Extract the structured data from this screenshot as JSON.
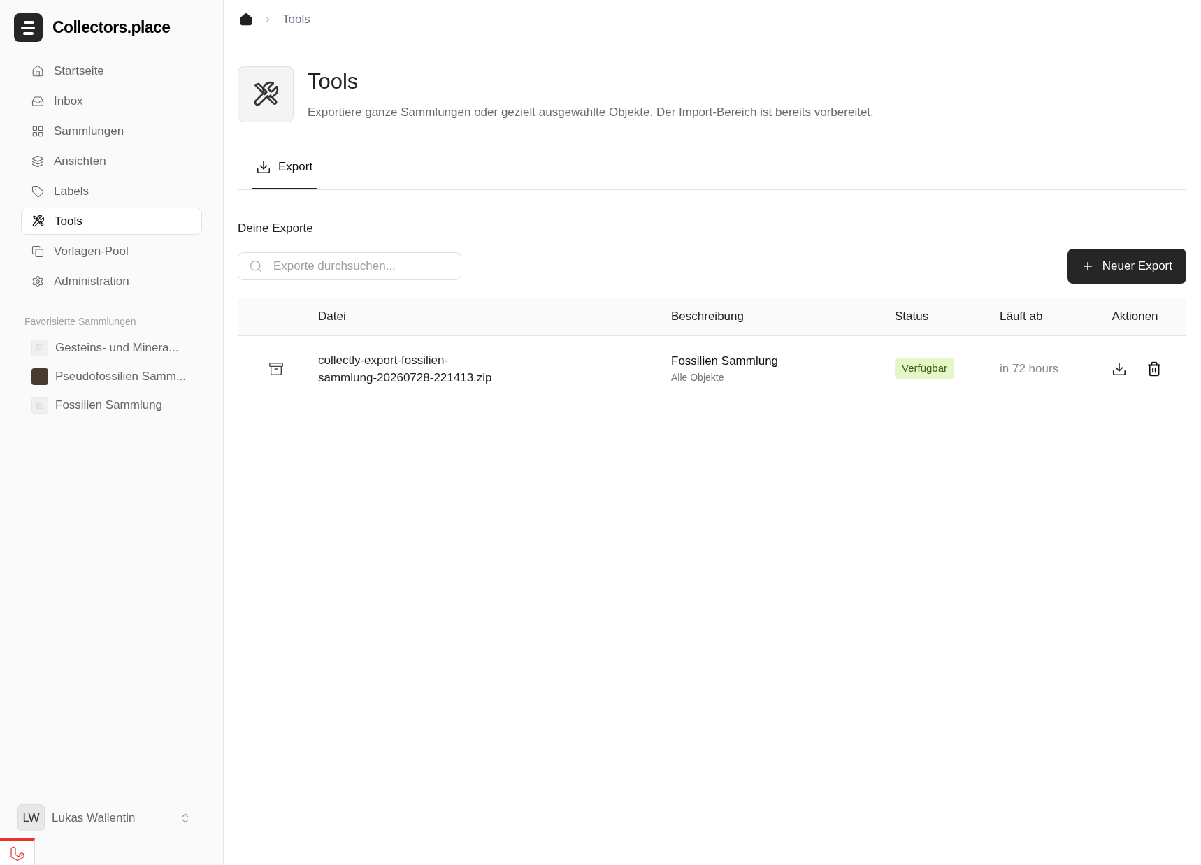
{
  "brand": {
    "name": "Collectors.place"
  },
  "nav": [
    {
      "label": "Startseite",
      "selected": false
    },
    {
      "label": "Inbox",
      "selected": false
    },
    {
      "label": "Sammlungen",
      "selected": false
    },
    {
      "label": "Ansichten",
      "selected": false
    },
    {
      "label": "Labels",
      "selected": false
    },
    {
      "label": "Tools",
      "selected": true
    },
    {
      "label": "Vorlagen-Pool",
      "selected": false
    },
    {
      "label": "Administration",
      "selected": false
    }
  ],
  "favorites": {
    "heading": "Favorisierte Sammlungen",
    "items": [
      {
        "label": "Gesteins- und Minera...",
        "kind": "placeholder"
      },
      {
        "label": "Pseudofossilien Samm...",
        "kind": "photo"
      },
      {
        "label": "Fossilien Sammlung",
        "kind": "placeholder"
      }
    ]
  },
  "user": {
    "initials": "LW",
    "name": "Lukas Wallentin"
  },
  "breadcrumb": [
    {
      "label": "Tools"
    }
  ],
  "page": {
    "title": "Tools",
    "description": "Exportiere ganze Sammlungen oder gezielt ausgewählte Objekte. Der Import-Bereich ist bereits vorbereitet."
  },
  "tabs": [
    {
      "label": "Export",
      "selected": true
    }
  ],
  "section_title": "Deine Exporte",
  "search": {
    "placeholder": "Exporte durchsuchen..."
  },
  "new_button": "Neuer Export",
  "table": {
    "columns": [
      "Datei",
      "Beschreibung",
      "Status",
      "Läuft ab",
      "Aktionen"
    ],
    "rows": [
      {
        "file": "collectly-export-fossilien-sammlung-20260728-221413.zip",
        "description": "Fossilien Sammlung",
        "scope": "Alle Objekte",
        "status": "Verfügbar",
        "expires": "in 72 hours"
      }
    ]
  }
}
